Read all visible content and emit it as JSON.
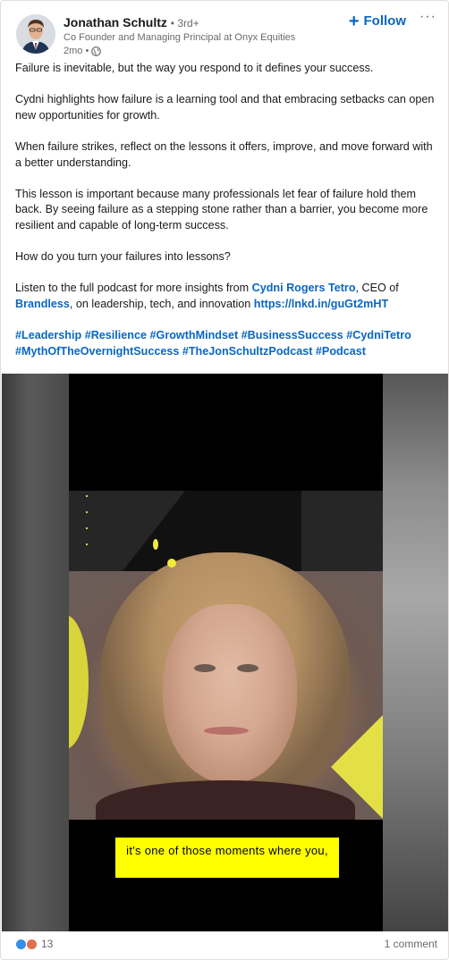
{
  "post": {
    "author": {
      "name": "Jonathan Schultz",
      "degree": "• 3rd+",
      "headline": "Co Founder and Managing Principal at Onyx Equities",
      "time": "2mo •",
      "visibility_icon": "globe-icon"
    },
    "follow_label": "Follow",
    "more_label": "···",
    "body": {
      "p1": "Failure is inevitable, but the way you respond to it defines your success.",
      "p2": "Cydni highlights how failure is a learning tool and that embracing setbacks can open new opportunities for growth.",
      "p3": "When failure strikes, reflect on the lessons it offers, improve, and move forward with a better understanding.",
      "p4": "This lesson is important because many professionals let fear of failure hold them back. By seeing failure as a stepping stone rather than a barrier, you become more resilient and capable of long-term success.",
      "p5": "How do you turn your failures into lessons?",
      "p6_a": "Listen to the full podcast for more insights from ",
      "p6_mention1": "Cydni Rogers Tetro",
      "p6_b": ", CEO of ",
      "p6_mention2": "Brandless",
      "p6_c": ", on leadership, tech, and innovation ",
      "p6_url": "https://lnkd.in/guGt2mHT",
      "hashtags": [
        "#Leadership",
        "#Resilience",
        "#GrowthMindset",
        "#BusinessSuccess",
        "#CydniTetro",
        "#MythOfTheOvernightSuccess",
        "#TheJonSchultzPodcast",
        "#Podcast"
      ]
    },
    "video": {
      "caption": "it's one of those moments where you,"
    },
    "social": {
      "reaction_icons": [
        "like-icon",
        "love-icon"
      ],
      "reaction_count": "13",
      "comment_count": "1 comment"
    },
    "colors": {
      "link": "#0a66c2",
      "caption_bg": "#ffff00",
      "accent_yellow": "#e3e046"
    }
  }
}
